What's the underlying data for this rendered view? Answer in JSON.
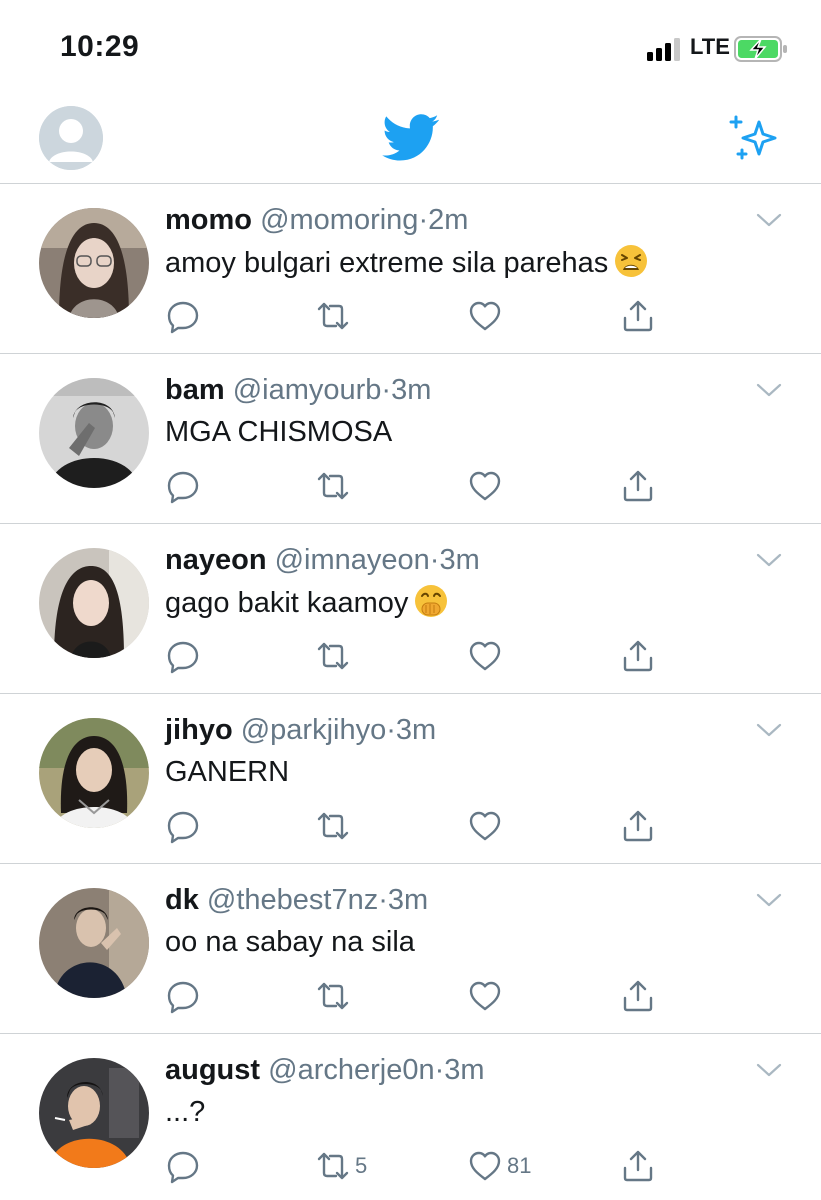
{
  "status_bar": {
    "time": "10:29",
    "network": "LTE"
  },
  "nav": {
    "logo": "twitter-bird-icon",
    "sparkle": "sparkle-icon"
  },
  "colors": {
    "brand": "#1da1f2",
    "secondary_text": "#657786",
    "divider": "#cfd3d6",
    "battery": "#4cd964"
  },
  "tweets": [
    {
      "name": "momo",
      "handle": "@momoring",
      "dot": "·",
      "time": "2m",
      "text": "amoy bulgari extreme sila parehas",
      "emoji": "tired-face-emoji",
      "retweets": "",
      "likes": ""
    },
    {
      "name": "bam",
      "handle": "@iamyourb",
      "dot": "·",
      "time": "3m",
      "text": "MGA CHISMOSA",
      "emoji": "",
      "retweets": "",
      "likes": ""
    },
    {
      "name": "nayeon",
      "handle": "@imnayeon",
      "dot": "·",
      "time": "3m",
      "text": "gago bakit kaamoy",
      "emoji": "hand-over-mouth-emoji",
      "retweets": "",
      "likes": ""
    },
    {
      "name": "jihyo",
      "handle": "@parkjihyo",
      "dot": "·",
      "time": "3m",
      "text": "GANERN",
      "emoji": "",
      "retweets": "",
      "likes": ""
    },
    {
      "name": "dk",
      "handle": "@thebest7nz",
      "dot": "·",
      "time": "3m",
      "text": "oo na sabay na sila",
      "emoji": "",
      "retweets": "",
      "likes": ""
    },
    {
      "name": "august",
      "handle": "@archerje0n",
      "dot": "·",
      "time": "3m",
      "text": "...?",
      "emoji": "",
      "retweets": "5",
      "likes": "81"
    }
  ]
}
